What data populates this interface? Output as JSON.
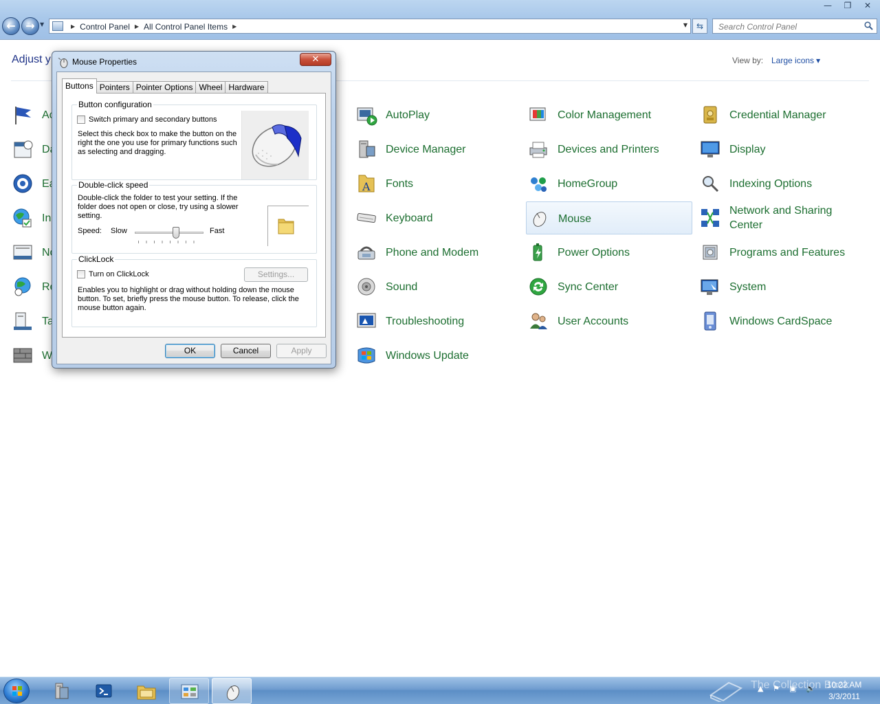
{
  "window": {
    "caption_buttons": [
      "minimize",
      "maximize",
      "close"
    ]
  },
  "address_bar": {
    "crumbs": [
      "Control Panel",
      "All Control Panel Items"
    ]
  },
  "search": {
    "placeholder": "Search Control Panel"
  },
  "header": {
    "title": "Adjust y",
    "view_by_label": "View by:",
    "view_by_value": "Large icons"
  },
  "left_column_partial": [
    {
      "label": "Ac",
      "icon": "action-center-flag-icon"
    },
    {
      "label": "Da",
      "icon": "date-time-icon"
    },
    {
      "label": "Ea",
      "icon": "ease-of-access-icon"
    },
    {
      "label": "In",
      "icon": "internet-options-icon"
    },
    {
      "label": "No",
      "icon": "notification-area-icon"
    },
    {
      "label": "Re",
      "icon": "region-language-icon"
    },
    {
      "label": "Ta",
      "icon": "taskbar-start-menu-icon"
    },
    {
      "label": "W",
      "icon": "windows-firewall-icon"
    }
  ],
  "items": [
    {
      "label": "AutoPlay",
      "icon": "autoplay-icon"
    },
    {
      "label": "Color Management",
      "icon": "color-management-icon"
    },
    {
      "label": "Credential Manager",
      "icon": "credential-manager-icon"
    },
    {
      "label": "Device Manager",
      "icon": "device-manager-icon"
    },
    {
      "label": "Devices and Printers",
      "icon": "devices-printers-icon"
    },
    {
      "label": "Display",
      "icon": "display-icon"
    },
    {
      "label": "Fonts",
      "icon": "fonts-icon"
    },
    {
      "label": "HomeGroup",
      "icon": "homegroup-icon"
    },
    {
      "label": "Indexing Options",
      "icon": "indexing-options-icon"
    },
    {
      "label": "Keyboard",
      "icon": "keyboard-icon"
    },
    {
      "label": "Mouse",
      "icon": "mouse-icon",
      "selected": true
    },
    {
      "label": "Network and Sharing Center",
      "icon": "network-sharing-icon"
    },
    {
      "label": "Phone and Modem",
      "icon": "phone-modem-icon"
    },
    {
      "label": "Power Options",
      "icon": "power-options-icon"
    },
    {
      "label": "Programs and Features",
      "icon": "programs-features-icon"
    },
    {
      "label": "Sound",
      "icon": "sound-icon"
    },
    {
      "label": "Sync Center",
      "icon": "sync-center-icon"
    },
    {
      "label": "System",
      "icon": "system-icon"
    },
    {
      "label": "Troubleshooting",
      "icon": "troubleshooting-icon"
    },
    {
      "label": "User Accounts",
      "icon": "user-accounts-icon"
    },
    {
      "label": "Windows CardSpace",
      "icon": "windows-cardspace-icon"
    },
    {
      "label": "Windows Update",
      "icon": "windows-update-icon"
    }
  ],
  "dialog": {
    "title": "Mouse Properties",
    "tabs": [
      "Buttons",
      "Pointers",
      "Pointer Options",
      "Wheel",
      "Hardware"
    ],
    "active_tab": "Buttons",
    "button_config": {
      "title": "Button configuration",
      "checkbox_label": "Switch primary and secondary buttons",
      "checked": false,
      "description_lines": [
        "Select this check box to make the button on the",
        "right the one you use for primary functions such",
        "as selecting and dragging."
      ]
    },
    "double_click": {
      "title": "Double-click speed",
      "description_lines": [
        "Double-click the folder to test your setting. If the",
        "folder does not open or close, try using a slower",
        "setting."
      ],
      "speed_label": "Speed:",
      "slow_label": "Slow",
      "fast_label": "Fast",
      "speed_fraction": 0.6
    },
    "clicklock": {
      "title": "ClickLock",
      "checkbox_label": "Turn on ClickLock",
      "checked": false,
      "settings_button": "Settings...",
      "description_lines": [
        "Enables you to highlight or drag without holding down the mouse",
        "button. To set, briefly press the mouse button. To release, click the",
        "mouse button again."
      ]
    },
    "buttons": {
      "ok": "OK",
      "cancel": "Cancel",
      "apply": "Apply"
    }
  },
  "taskbar": {
    "pinned": [
      "server-manager-icon",
      "powershell-icon",
      "windows-explorer-icon",
      "control-panel-icon",
      "mouse-properties-icon"
    ],
    "clock_time": "10:22 AM",
    "clock_date": "3/3/2011",
    "watermark": "The Collection Book"
  },
  "colors": {
    "item_text": "#1c6e30",
    "heading_text": "#1e3287",
    "link_text": "#1f4ea3"
  }
}
